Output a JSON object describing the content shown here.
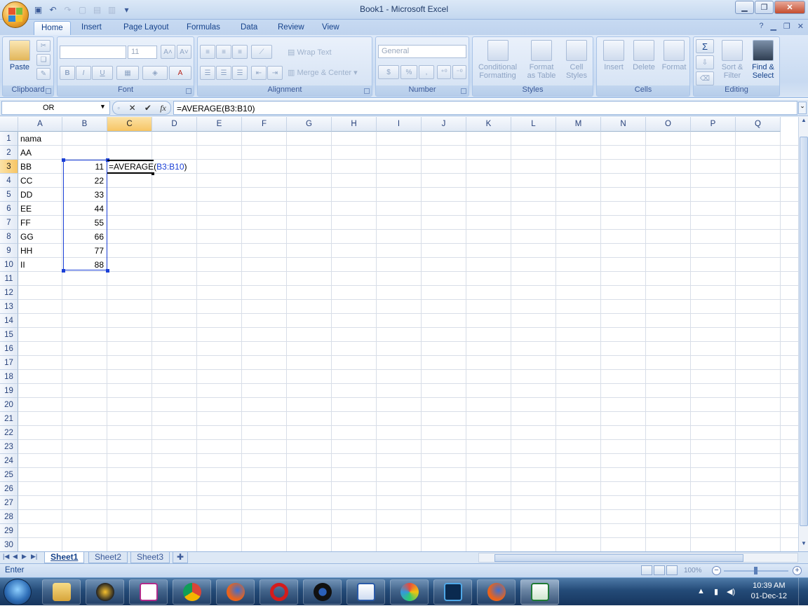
{
  "window": {
    "title": "Book1 - Microsoft Excel"
  },
  "ribbon": {
    "tabs": [
      "Home",
      "Insert",
      "Page Layout",
      "Formulas",
      "Data",
      "Review",
      "View"
    ],
    "active_tab": "Home",
    "clipboard": {
      "label": "Clipboard",
      "paste": "Paste"
    },
    "font": {
      "label": "Font",
      "size": "11",
      "bold": "B",
      "italic": "I",
      "underline": "U"
    },
    "alignment": {
      "label": "Alignment",
      "wrap_text": "Wrap Text",
      "merge_center": "Merge & Center"
    },
    "number": {
      "label": "Number",
      "format": "General",
      "currency": "$",
      "percent": "%",
      "comma": ","
    },
    "styles": {
      "label": "Styles",
      "conditional": [
        "Conditional",
        "Formatting"
      ],
      "format_table": [
        "Format",
        "as Table"
      ],
      "cell_styles": [
        "Cell",
        "Styles"
      ]
    },
    "cells": {
      "label": "Cells",
      "insert": "Insert",
      "delete": "Delete",
      "format": "Format"
    },
    "editing": {
      "label": "Editing",
      "sort_filter": [
        "Sort &",
        "Filter"
      ],
      "find_select": [
        "Find &",
        "Select"
      ],
      "sigma": "Σ"
    }
  },
  "formula_bar": {
    "name_box": "OR",
    "fx": "fx",
    "formula": "=AVERAGE(B3:B10)"
  },
  "sheet": {
    "columns": [
      "A",
      "B",
      "C",
      "D",
      "E",
      "F",
      "G",
      "H",
      "I",
      "J",
      "K",
      "L",
      "M",
      "N",
      "O",
      "P",
      "Q"
    ],
    "selected_column": "C",
    "rows": [
      "1",
      "2",
      "3",
      "4",
      "5",
      "6",
      "7",
      "8",
      "9",
      "10",
      "11",
      "12",
      "13",
      "14",
      "15",
      "16",
      "17",
      "18",
      "19",
      "20",
      "21",
      "22",
      "23",
      "24",
      "25",
      "26",
      "27",
      "28",
      "29",
      "30"
    ],
    "selected_row": "3",
    "col_a": [
      "nama",
      "AA",
      "BB",
      "CC",
      "DD",
      "EE",
      "FF",
      "GG",
      "HH",
      "II"
    ],
    "col_b": [
      "",
      "",
      "11",
      "22",
      "33",
      "44",
      "55",
      "66",
      "77",
      "88"
    ],
    "edit_cell": {
      "prefix": "=AVERAGE(",
      "ref": "B3:B10",
      "suffix": ")"
    }
  },
  "sheet_tabs": {
    "tabs": [
      "Sheet1",
      "Sheet2",
      "Sheet3"
    ],
    "active": "Sheet1"
  },
  "status": {
    "mode": "Enter",
    "zoom": "100%"
  },
  "taskbar": {
    "time": "10:39 AM",
    "date": "01-Dec-12"
  },
  "colors": {
    "accent": "#15428b",
    "selection": "#1a3fd6",
    "header_highlight": "#f7c564"
  }
}
